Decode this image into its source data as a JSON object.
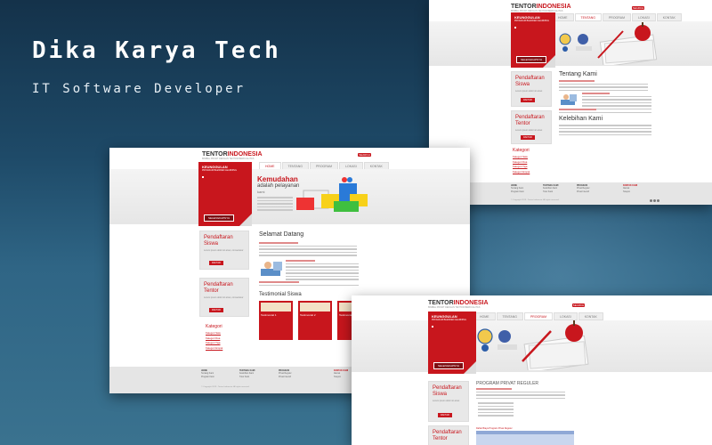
{
  "brand": {
    "title": "Dika Karya Tech",
    "tagline": "IT Software Developer"
  },
  "site": {
    "logo_main": "TENTOR",
    "logo_accent": "INDONESIA",
    "logo_sub": "BIMBEL PRIVAT DENGAN TENTOR BERKUALITAS",
    "search_button": "SEARCH",
    "nav": [
      "HOME",
      "TENTANG",
      "PROGRAM",
      "LOKASI",
      "KONTAK"
    ],
    "panel_title": "KEUNGGULAN",
    "panel_subtitle": "PROGRAM BLENDED LEARNING",
    "panel_button": "SELENGKAPNYA",
    "side_siswa": "Pendaftaran Siswa",
    "side_tentor": "Pendaftaran Tentor",
    "side_button": "DAFTAR",
    "kategori_title": "Kategori",
    "kategori_items": [
      "Kategori Satu",
      "Kategori Dua",
      "Kategori Tiga",
      "Kategori Empat"
    ],
    "copyright": "© Copyright 2013 - Tentor Indonesia. All rights reserved.",
    "footer_cols": [
      [
        "HOME",
        "Tentang Kami",
        "Program Kami"
      ],
      [
        "TENTANG KAMI",
        "Kelebihan Kami",
        "Tutor Kami"
      ],
      [
        "PROGRAM",
        "Privat Reguler",
        "Privat Intensif"
      ],
      [
        "KONTAK KAMI",
        "Alamat",
        "Telepon"
      ]
    ]
  },
  "shot1": {
    "about_title": "Tentang Kami",
    "advantages_title": "Kelebihan Kami",
    "active_tab": "TENTANG"
  },
  "shot2": {
    "hero_title": "Kemudahan",
    "hero_subtitle": "adalah pelayanan",
    "hero_subtitle2": "kami",
    "welcome_title": "Selamat Datang",
    "testimonial_title": "Testimonial Siswa",
    "testimonials": [
      "Testimonial 1",
      "Testimonial 2",
      "Testimonial 3"
    ],
    "active_tab": "HOME"
  },
  "shot3": {
    "program_title": "PROGRAM PRIVAT REGULER",
    "table_caption": "Daftar Biaya Program Privat Reguler",
    "active_tab": "PROGRAM"
  },
  "colors": {
    "accent": "#c8161d",
    "background": "#1e4a68"
  }
}
